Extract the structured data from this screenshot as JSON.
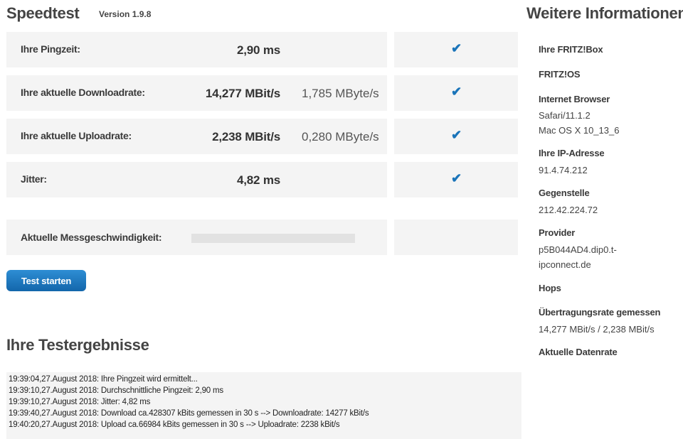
{
  "header": {
    "title": "Speedtest",
    "version": "Version 1.9.8"
  },
  "rows": [
    {
      "label": "Ihre Pingzeit:",
      "value": "2,90 ms",
      "secondary": ""
    },
    {
      "label": "Ihre aktuelle Downloadrate:",
      "value": "14,277 MBit/s",
      "secondary": "1,785 MByte/s"
    },
    {
      "label": "Ihre aktuelle Uploadrate:",
      "value": "2,238 MBit/s",
      "secondary": "0,280 MByte/s"
    },
    {
      "label": "Jitter:",
      "value": "4,82 ms",
      "secondary": ""
    }
  ],
  "check_symbol": "✔",
  "measurement": {
    "label": "Aktuelle Messgeschwindigkeit:",
    "progress_fraction": 0
  },
  "start_button": {
    "label": "Test starten"
  },
  "results": {
    "title": "Ihre Testergebnisse",
    "log": [
      "19:39:04,27.August 2018: Ihre Pingzeit wird ermittelt...",
      "19:39:10,27.August 2018: Durchschnittliche Pingzeit: 2,90 ms",
      "19:39:10,27.August 2018: Jitter: 4,82 ms",
      "19:39:40,27.August 2018: Download ca.428307 kBits gemessen in 30 s --> Downloadrate: 14277 kBit/s",
      "19:40:20,27.August 2018: Upload ca.66984 kBits gemessen in 30 s --> Uploadrate: 2238 kBit/s"
    ]
  },
  "sidebar": {
    "title": "Weitere Informationen",
    "fritzbox_label": "Ihre FRITZ!Box",
    "fritzos_label": "FRITZ!OS",
    "browser_label": "Internet Browser",
    "browser_value_1": "Safari/11.1.2",
    "browser_value_2": "Mac OS X 10_13_6",
    "ip_label": "Ihre IP-Adresse",
    "ip_value": "91.4.74.212",
    "remote_label": "Gegenstelle",
    "remote_value": "212.42.224.72",
    "provider_label": "Provider",
    "provider_value_1": "p5B044AD4.dip0.t-",
    "provider_value_2": "ipconnect.de",
    "hops_label": "Hops",
    "rate_label": "Übertragungsrate gemessen",
    "rate_value": "14,277 MBit/s / 2,238 MBit/s",
    "datarate_label": "Aktuelle Datenrate"
  },
  "colors": {
    "accent": "#1a74b9",
    "panel": "#f4f4f4",
    "button_top": "#2e8ed4",
    "button_bottom": "#1366ab"
  }
}
